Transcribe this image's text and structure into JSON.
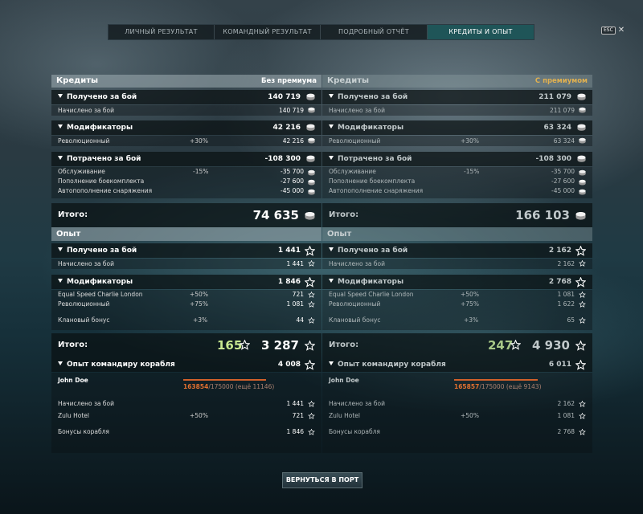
{
  "tabs": [
    "ЛИЧНЫЙ РЕЗУЛЬТАТ",
    "КОМАНДНЫЙ РЕЗУЛЬТАТ",
    "ПОДРОБНЫЙ ОТЧЁТ",
    "КРЕДИТЫ И ОПЫТ"
  ],
  "active_tab": 3,
  "esc_label": "ESC",
  "icons": {
    "credit": "credit-coin-icon",
    "xp": "xp-star-icon",
    "collapse": "triangle-down-icon",
    "close": "close-icon"
  },
  "left": {
    "credits_title": "Кредиты",
    "credits_mode": "Без премиума",
    "earned_label": "Получено за бой",
    "earned_value": "140 719",
    "earned_sub_label": "Начислено за бой",
    "earned_sub_value": "140 719",
    "mods_label": "Модификаторы",
    "mods_value": "42 216",
    "mod1_label": "Революционный",
    "mod1_pct": "+30%",
    "mod1_value": "42 216",
    "spent_label": "Потрачено за бой",
    "spent_value": "-108 300",
    "spent1_label": "Обслуживание",
    "spent1_pct": "-15%",
    "spent1_value": "-35 700",
    "spent2_label": "Пополнение боекомплекта",
    "spent2_value": "-27 600",
    "spent3_label": "Автопополнение снаряжения",
    "spent3_value": "-45 000",
    "total_label": "Итого:",
    "total_value": "74 635",
    "xp_title": "Опыт",
    "xp_earned_label": "Получено за бой",
    "xp_earned_value": "1 441",
    "xp_earned_sub_label": "Начислено за бой",
    "xp_earned_sub_value": "1 441",
    "xp_mods_label": "Модификаторы",
    "xp_mods_value": "1 846",
    "xp_mod1_label": "Equal Speed Charlie London",
    "xp_mod1_pct": "+50%",
    "xp_mod1_value": "721",
    "xp_mod2_label": "Революционный",
    "xp_mod2_pct": "+75%",
    "xp_mod2_value": "1 081",
    "xp_clan_label": "Клановый бонус",
    "xp_clan_pct": "+3%",
    "xp_clan_value": "44",
    "xp_total_label": "Итого:",
    "xp_total_free": "165",
    "xp_total_value": "3 287",
    "cmdr_label": "Опыт командиру корабля",
    "cmdr_value": "4 008",
    "cmdr_name": "John Doe",
    "cmdr_progress_current": "163854",
    "cmdr_progress_max": "/175000",
    "cmdr_progress_remaining": "(ещё 11146)",
    "cmdr_progress_fraction": 0.936,
    "cmdr_line1_label": "Начислено за бой",
    "cmdr_line1_value": "1 441",
    "cmdr_line2_label": "Zulu Hotel",
    "cmdr_line2_pct": "+50%",
    "cmdr_line2_value": "721",
    "cmdr_line3_label": "Бонусы корабля",
    "cmdr_line3_value": "1 846"
  },
  "right": {
    "credits_title": "Кредиты",
    "credits_mode": "С премиумом",
    "earned_label": "Получено за бой",
    "earned_value": "211 079",
    "earned_sub_label": "Начислено за бой",
    "earned_sub_value": "211 079",
    "mods_label": "Модификаторы",
    "mods_value": "63 324",
    "mod1_label": "Революционный",
    "mod1_pct": "+30%",
    "mod1_value": "63 324",
    "spent_label": "Потрачено за бой",
    "spent_value": "-108 300",
    "spent1_label": "Обслуживание",
    "spent1_pct": "-15%",
    "spent1_value": "-35 700",
    "spent2_label": "Пополнение боекомплекта",
    "spent2_value": "-27 600",
    "spent3_label": "Автопополнение снаряжения",
    "spent3_value": "-45 000",
    "total_label": "Итого:",
    "total_value": "166 103",
    "xp_title": "Опыт",
    "xp_earned_label": "Получено за бой",
    "xp_earned_value": "2 162",
    "xp_earned_sub_label": "Начислено за бой",
    "xp_earned_sub_value": "2 162",
    "xp_mods_label": "Модификаторы",
    "xp_mods_value": "2 768",
    "xp_mod1_label": "Equal Speed Charlie London",
    "xp_mod1_pct": "+50%",
    "xp_mod1_value": "1 081",
    "xp_mod2_label": "Революционный",
    "xp_mod2_pct": "+75%",
    "xp_mod2_value": "1 622",
    "xp_clan_label": "Клановый бонус",
    "xp_clan_pct": "+3%",
    "xp_clan_value": "65",
    "xp_total_label": "Итого:",
    "xp_total_free": "247",
    "xp_total_value": "4 930",
    "cmdr_label": "Опыт командиру корабля",
    "cmdr_value": "6 011",
    "cmdr_name": "John Doe",
    "cmdr_progress_current": "165857",
    "cmdr_progress_max": "/175000",
    "cmdr_progress_remaining": "(ещё 9143)",
    "cmdr_progress_fraction": 0.948,
    "cmdr_line1_label": "Начислено за бой",
    "cmdr_line1_value": "2 162",
    "cmdr_line2_label": "Zulu Hotel",
    "cmdr_line2_pct": "+50%",
    "cmdr_line2_value": "1 081",
    "cmdr_line3_label": "Бонусы корабля",
    "cmdr_line3_value": "2 768"
  },
  "return_button": "ВЕРНУТЬСЯ В ПОРТ",
  "colors": {
    "accent_tab": "#1f5558",
    "premium": "#e0b050",
    "progress": "#e07030",
    "free_xp": "#c8e890"
  }
}
